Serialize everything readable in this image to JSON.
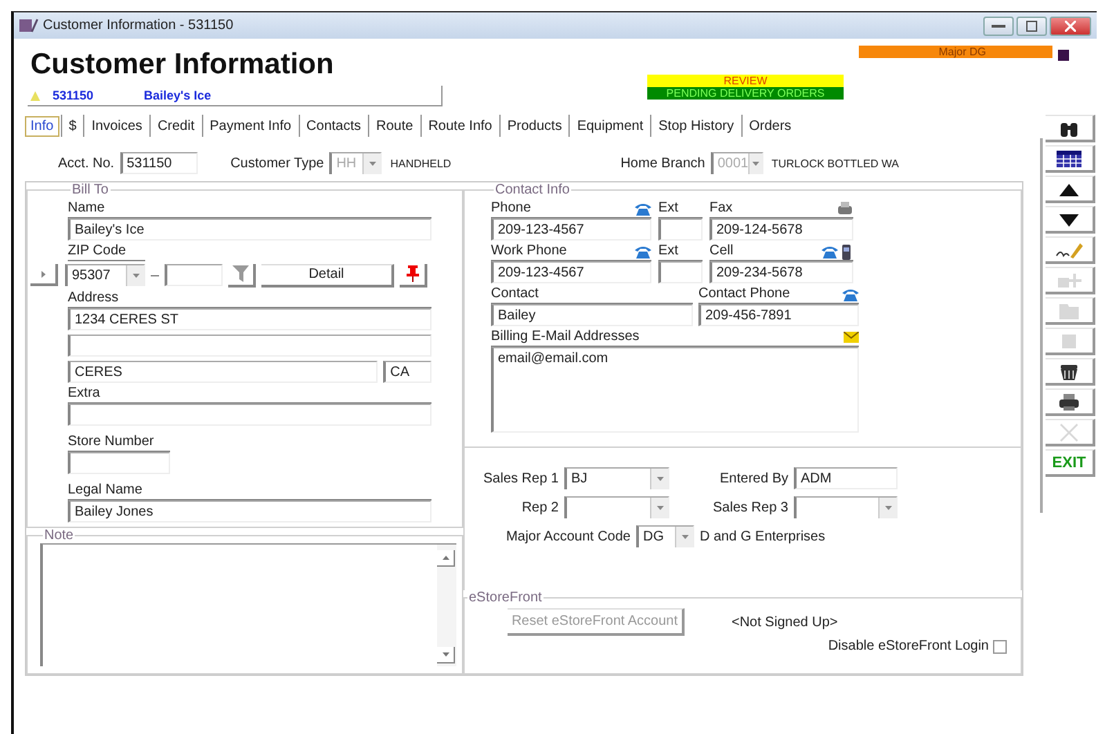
{
  "window": {
    "title": "Customer Information - 531150"
  },
  "header": {
    "title": "Customer Information",
    "major_badge": "Major DG",
    "account_number": "531150",
    "account_name": "Bailey's Ice",
    "alerts": [
      {
        "text": "REVIEW",
        "color": "#ffff00"
      },
      {
        "text": "PENDING DELIVERY ORDERS",
        "color": "#008a00"
      }
    ]
  },
  "tabs": [
    {
      "label": "Info",
      "selected": true
    },
    {
      "label": "$",
      "selected": false
    },
    {
      "label": "Invoices",
      "selected": false
    },
    {
      "label": "Credit",
      "selected": false
    },
    {
      "label": "Payment Info",
      "selected": false
    },
    {
      "label": "Contacts",
      "selected": false
    },
    {
      "label": "Route",
      "selected": false
    },
    {
      "label": "Route Info",
      "selected": false
    },
    {
      "label": "Products",
      "selected": false
    },
    {
      "label": "Equipment",
      "selected": false
    },
    {
      "label": "Stop History",
      "selected": false
    },
    {
      "label": "Orders",
      "selected": false
    }
  ],
  "account_fields": [
    {
      "kind": "text",
      "label": "Acct. No.",
      "value": "531150",
      "disabled": false
    },
    {
      "kind": "combo",
      "label": "Customer Type",
      "value": "HH",
      "disabled": true,
      "description": "HANDHELD"
    },
    {
      "kind": "combo",
      "label": "Home Branch",
      "value": "0001",
      "disabled": true,
      "description": "TURLOCK BOTTLED WA"
    }
  ],
  "bill_to": {
    "legend": "Bill To",
    "name_label": "Name",
    "name": "Bailey's Ice",
    "zip_label": "ZIP Code",
    "zip": "95307",
    "detail_button": "Detail",
    "address_label": "Address",
    "address_1": "1234 CERES ST",
    "city": "CERES",
    "state": "CA",
    "extra_label": "Extra",
    "store_number_label": "Store Number",
    "legal_name_label": "Legal Name",
    "legal_name": "Bailey Jones"
  },
  "note": {
    "legend": "Note"
  },
  "contact_info": {
    "legend": "Contact Info",
    "phone_label": "Phone",
    "phone": "209-123-4567",
    "ext_label": "Ext",
    "fax_label": "Fax",
    "fax": "209-124-5678",
    "work_phone_label": "Work Phone",
    "work_phone": "209-123-4567",
    "work_ext_label": "Ext",
    "cell_label": "Cell",
    "cell": "209-234-5678",
    "contact_label": "Contact",
    "contact": "Bailey",
    "contact_phone_label": "Contact Phone",
    "contact_phone": "209-456-7891",
    "email_label": "Billing E-Mail Addresses",
    "email": "email@email.com"
  },
  "sales": {
    "sales_rep_1_label": "Sales Rep 1",
    "sales_rep_1": "BJ",
    "entered_by_label": "Entered By",
    "entered_by": "ADM",
    "rep_2_label": "Rep 2",
    "sales_rep_3_label": "Sales Rep 3",
    "major_account_code_label": "Major Account Code",
    "major_account_code": "DG",
    "major_account_name": "D and G Enterprises"
  },
  "estorefront": {
    "legend": "eStoreFront",
    "reset_button": "Reset eStoreFront Account",
    "reset_disabled": true,
    "status": "<Not Signed Up>",
    "disable_login_label": "Disable eStoreFront Login",
    "disable_login_checked": false
  },
  "toolbar": [
    {
      "kind": "find",
      "disabled": false
    },
    {
      "kind": "grid",
      "disabled": false
    },
    {
      "kind": "up",
      "disabled": false
    },
    {
      "kind": "down",
      "disabled": false
    },
    {
      "kind": "sign",
      "disabled": false
    },
    {
      "kind": "add",
      "disabled": true
    },
    {
      "kind": "copy",
      "disabled": true
    },
    {
      "kind": "save",
      "disabled": true
    },
    {
      "kind": "delete",
      "disabled": false
    },
    {
      "kind": "print",
      "disabled": false
    },
    {
      "kind": "cancel",
      "disabled": true
    },
    {
      "kind": "exit",
      "label": "EXIT",
      "disabled": false
    }
  ]
}
